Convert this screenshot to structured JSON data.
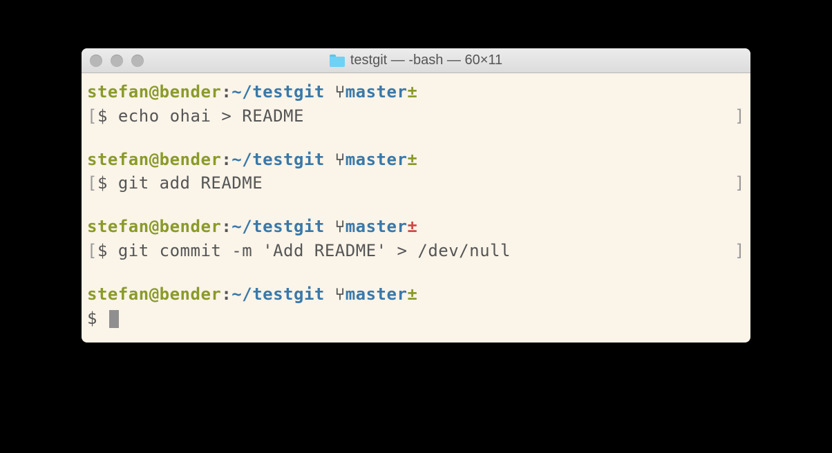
{
  "window": {
    "title": "testgit — -bash — 60×11"
  },
  "prompt": {
    "userhost": "stefan@bender",
    "colon": ":",
    "path": "~/testgit",
    "branch_arrow": "⑂",
    "branch": "master",
    "status_symbol": "±"
  },
  "blocks": [
    {
      "status_color": "olive",
      "left_bracket": "[",
      "cmd_prefix": "$ ",
      "command": "echo ohai > README",
      "right_bracket": "]"
    },
    {
      "status_color": "olive",
      "left_bracket": "[",
      "cmd_prefix": "$ ",
      "command": "git add README",
      "right_bracket": "]"
    },
    {
      "status_color": "red",
      "left_bracket": "[",
      "cmd_prefix": "$ ",
      "command": "git commit -m 'Add README' > /dev/null",
      "right_bracket": "]"
    }
  ],
  "current": {
    "status_color": "olive",
    "dollar": "$ "
  }
}
